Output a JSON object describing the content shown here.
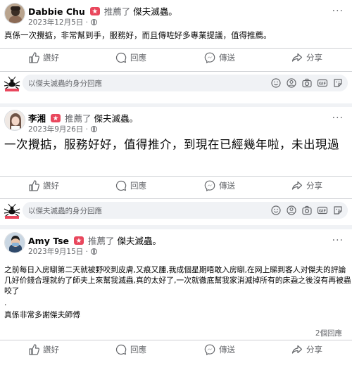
{
  "posts": [
    {
      "author": "Dabbie Chu",
      "recommend_text": "推薦了",
      "page_name": "傑夫滅蟲",
      "separator": "。",
      "date": "2023年12月5日",
      "date_sep": "·",
      "text": "真係一次攪掂，非常幫到手，服務好，而且傳咗好多專業提議，值得推薦。"
    },
    {
      "author": "李湘",
      "recommend_text": "推薦了",
      "page_name": "傑夫滅蟲",
      "separator": "。",
      "date": "2023年9月26日",
      "date_sep": "·",
      "text": "一次攪掂，服務好好，值得推介，到現在已經幾年啦，未出現過"
    },
    {
      "author": "Amy Tse",
      "recommend_text": "推薦了",
      "page_name": "傑夫滅蟲",
      "separator": "。",
      "date": "2023年9月15日",
      "date_sep": "·",
      "paragraphs": [
        "之前每日入房瞓第二天就被野咬到皮膚,又痕又腫,我成個星期唔敢入房瞓,在网上睇到客人对傑夫的評論几好价錢合理就約了師夫上來幫我滅蟲,真的太好了,一次就徹底幫我家消滅掉所有的床蝨之後沒有再被蟲咬了",
        ".",
        "真係非常多謝傑夫師傅"
      ],
      "comment_count": "2個回應"
    }
  ],
  "actions": {
    "like": "讚好",
    "comment": "回應",
    "send": "傳送",
    "share": "分享"
  },
  "comment_placeholder": "以傑夫滅蟲的身分回應",
  "more_glyph": "···",
  "colors": {
    "accent_red": "#e9475d",
    "secondary_text": "#65676b",
    "divider": "#ced0d4",
    "page_bg": "#f0f2f5"
  },
  "icons": [
    "thumbs-up-icon",
    "comment-bubble-icon",
    "messenger-icon",
    "share-arrow-icon",
    "avatar-badge-icon",
    "emoji-icon",
    "gif-icon",
    "camera-icon",
    "sticker-icon",
    "globe-icon"
  ]
}
